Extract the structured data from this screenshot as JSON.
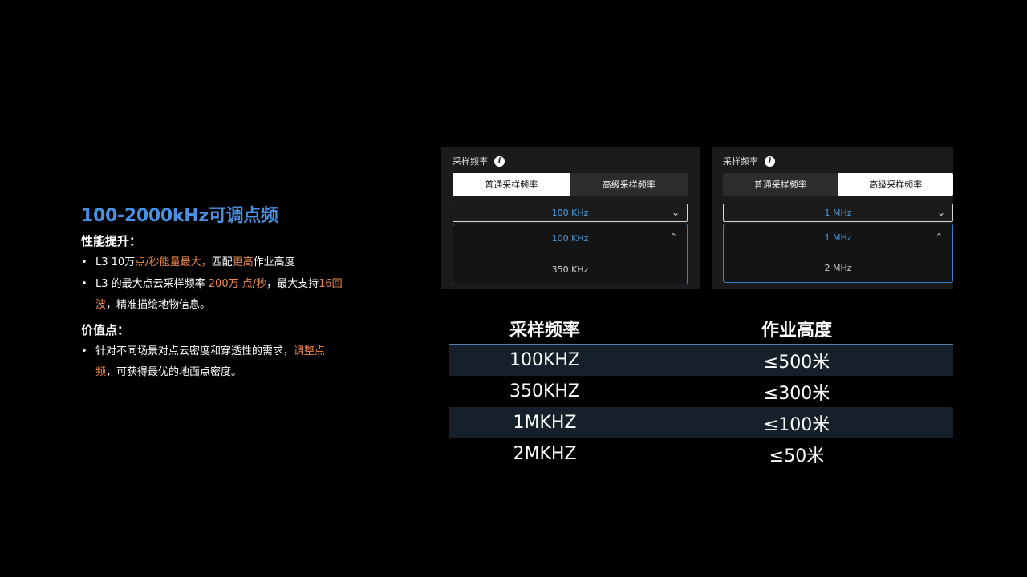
{
  "left": {
    "title": "100-2000kHz可调点频",
    "perf_heading": "性能提升：",
    "perf_items": [
      {
        "a": "L3 10万",
        "b": "点/秒能量最大，",
        "c": "匹配",
        "d": "更高",
        "e": "作业高度"
      },
      {
        "a": "L3 的最大点云采样频率 ",
        "b": "200万 点/秒",
        "c": "，最大支持",
        "d": "16回波",
        "e": "，精准描绘地物信息。"
      }
    ],
    "value_heading": "价值点：",
    "value_items": [
      {
        "a": "针对不同场景对点云密度和穿透性的需求，",
        "b": "调整点频",
        "c": "，可获得最优的地面点密度。"
      }
    ]
  },
  "panel1": {
    "label": "采样频率",
    "tab_normal": "普通采样频率",
    "tab_advanced": "高级采样频率",
    "selected_value": "100 KHz",
    "options": [
      "100 KHz",
      "350 KHz"
    ]
  },
  "panel2": {
    "label": "采样频率",
    "tab_normal": "普通采样频率",
    "tab_advanced": "高级采样频率",
    "selected_value": "1 MHz",
    "options": [
      "1 MHz",
      "2 MHz"
    ]
  },
  "table": {
    "headers": [
      "采样频率",
      "作业高度"
    ],
    "rows": [
      [
        "100KHZ",
        "≤500米"
      ],
      [
        "350KHZ",
        "≤300米"
      ],
      [
        "1MKHZ",
        "≤100米"
      ],
      [
        "2MKHZ",
        "≤50米"
      ]
    ]
  },
  "colors": {
    "title": "#4a90e2",
    "highlight": "#f08a4b",
    "select_blue": "#4a9de0"
  },
  "icons": {
    "info": "info-icon",
    "chevron_down": "chevron-down-icon",
    "chevron_up": "chevron-up-icon"
  }
}
